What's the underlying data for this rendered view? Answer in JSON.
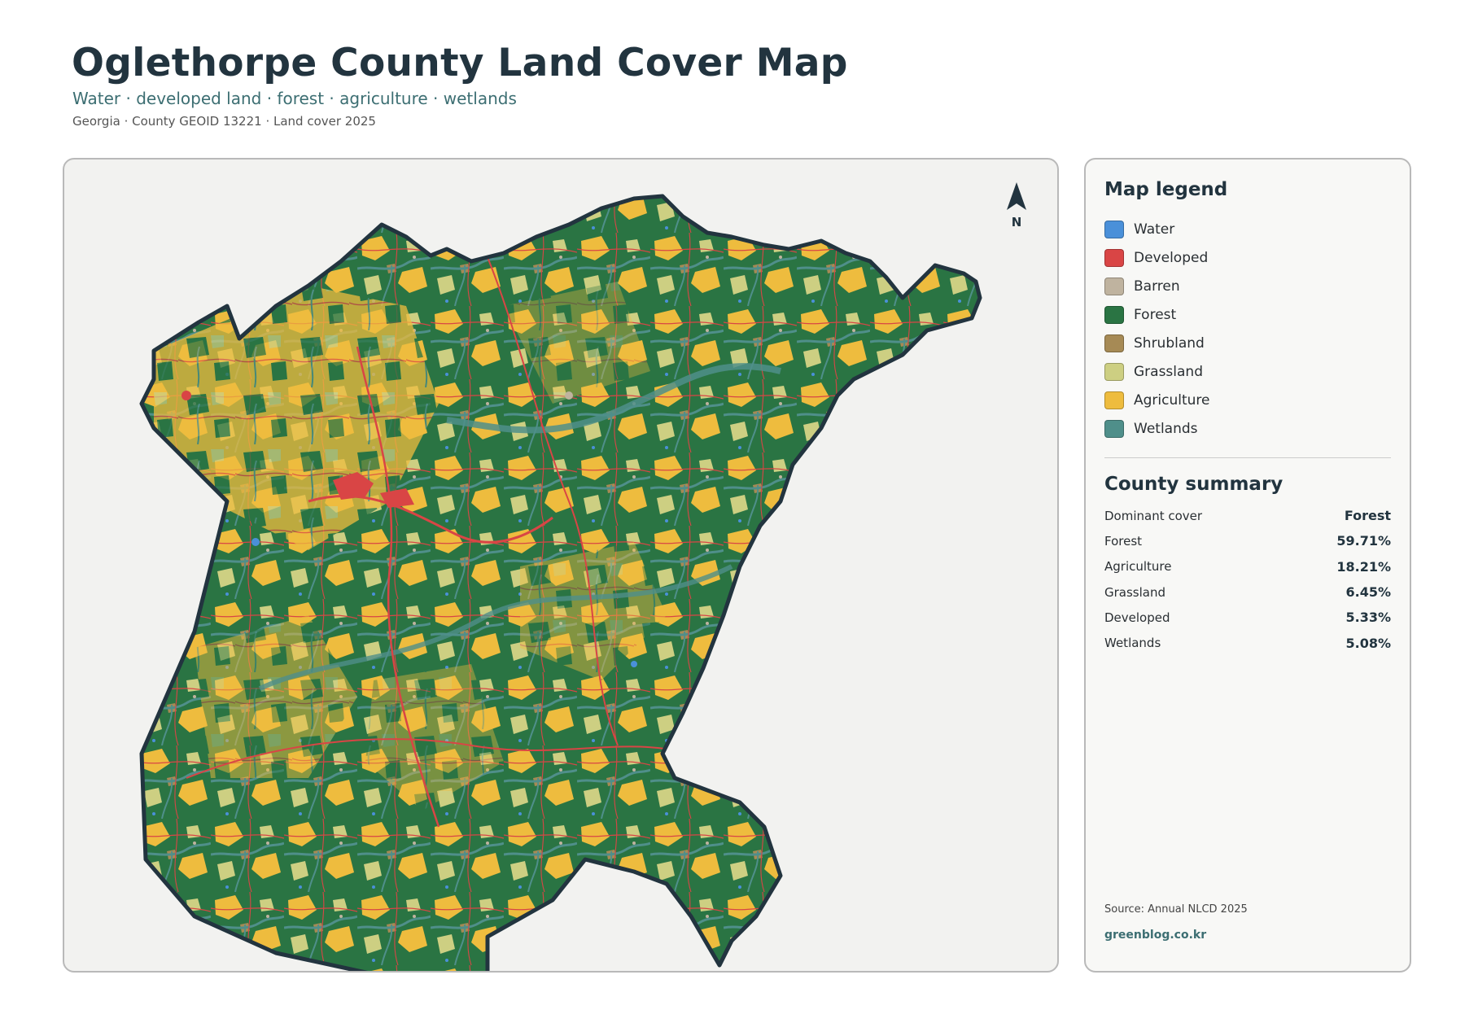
{
  "header": {
    "title": "Oglethorpe County Land Cover Map",
    "subtitle": "Water · developed land · forest · agriculture · wetlands",
    "meta": "Georgia · County GEOID 13221 · Land cover 2025"
  },
  "map": {
    "north_label": "N"
  },
  "legend": {
    "title": "Map legend",
    "items": [
      {
        "label": "Water",
        "color": "#4a90d9"
      },
      {
        "label": "Developed",
        "color": "#d94545"
      },
      {
        "label": "Barren",
        "color": "#bfb39f"
      },
      {
        "label": "Forest",
        "color": "#2a7443"
      },
      {
        "label": "Shrubland",
        "color": "#a68a55"
      },
      {
        "label": "Grassland",
        "color": "#cdcf82"
      },
      {
        "label": "Agriculture",
        "color": "#eebc3e"
      },
      {
        "label": "Wetlands",
        "color": "#4f8f8a"
      }
    ]
  },
  "summary": {
    "title": "County summary",
    "rows": [
      {
        "key": "Dominant cover",
        "value": "Forest"
      },
      {
        "key": "Forest",
        "value": "59.71%"
      },
      {
        "key": "Agriculture",
        "value": "18.21%"
      },
      {
        "key": "Grassland",
        "value": "6.45%"
      },
      {
        "key": "Developed",
        "value": "5.33%"
      },
      {
        "key": "Wetlands",
        "value": "5.08%"
      }
    ]
  },
  "footer": {
    "source": "Source: Annual NLCD 2025",
    "credit": "greenblog.co.kr"
  }
}
